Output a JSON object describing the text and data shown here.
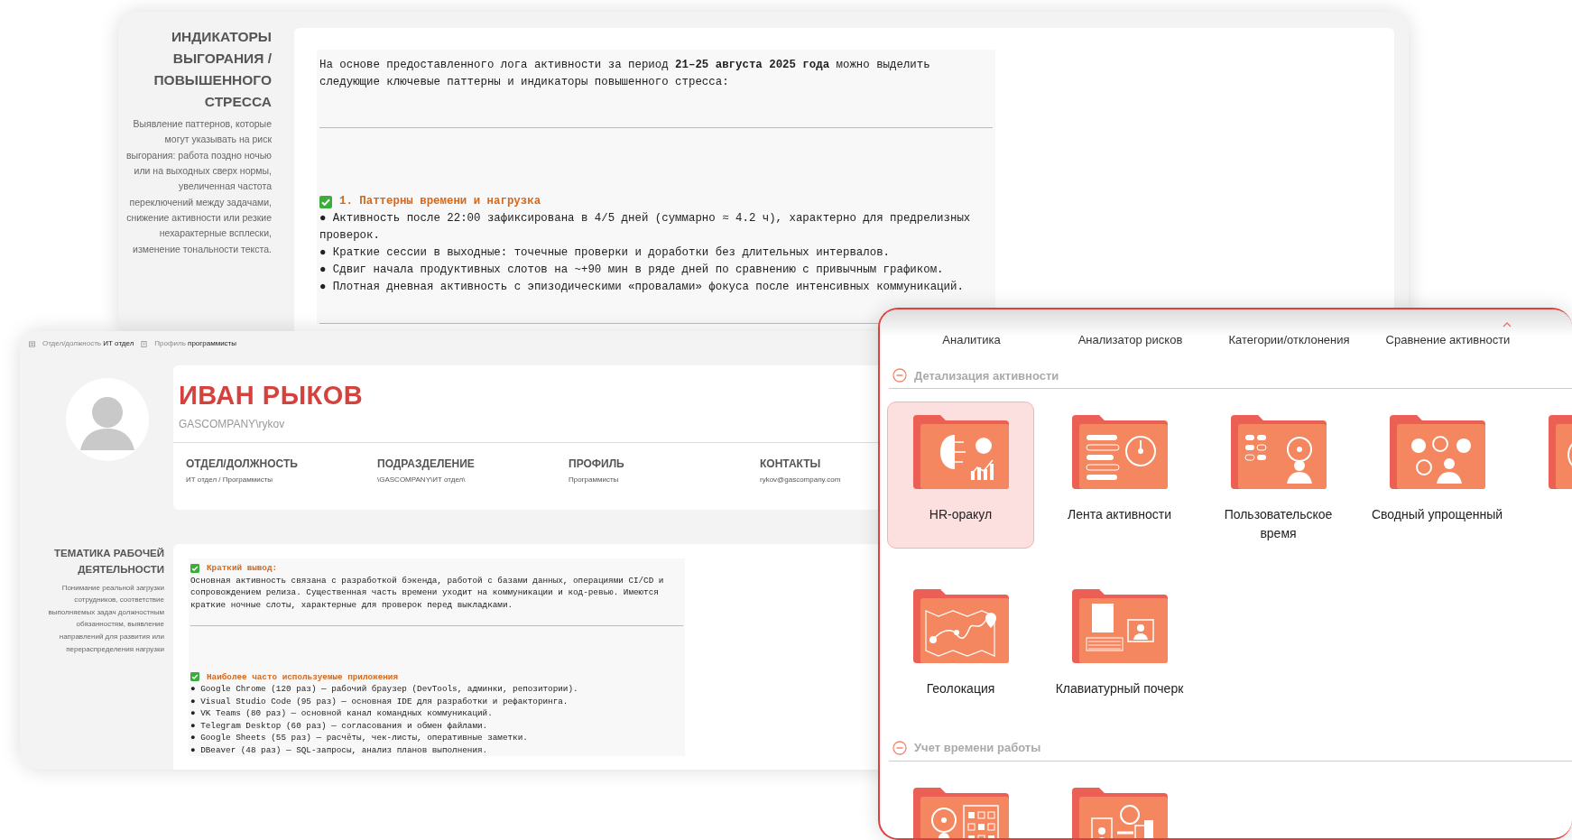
{
  "stress_panel": {
    "title": "ИНДИКАТОРЫ ВЫГОРАНИЯ / ПОВЫШЕННОГО СТРЕССА",
    "description": "Выявление паттернов, которые могут указывать на риск выгорания: работа поздно ночью или на выходных сверх нормы, увеличенная частота переключений между задачами, снижение активности или резкие нехарактерные всплески, изменение тональности текста.",
    "intro": "На основе предоставленного лога активности за период **21–25 августа 2025 года** можно выделить следующие ключевые паттерны и индикаторы повышенного стресса:",
    "sections": [
      {
        "heading": "1. Паттерны времени и нагрузка",
        "items": [
          "● Активность после 22:00 зафиксирована в 4/5 дней (суммарно ≈ 4.2 ч), характерно для предрелизных проверок.",
          "● Краткие сессии в выходные: точечные проверки и доработки без длительных интервалов.",
          "● Сдвиг начала продуктивных слотов на ~+90 мин в ряде дней по сравнению с привычным графиком.",
          "● Плотная дневная активность с эпизодическими «провалами» фокуса после интенсивных коммуникаций."
        ]
      }
    ]
  },
  "profile_panel": {
    "breadcrumbs": [
      {
        "label": "Отдел/должность",
        "value": "ИТ отдел"
      },
      {
        "label": "Профиль",
        "value": "программисты"
      }
    ],
    "name": "ИВАН РЫКОВ",
    "login": "GASCOMPANY\\rykov",
    "fields": [
      {
        "label": "ОТДЕЛ/ДОЛЖНОСТЬ",
        "value": "ИТ отдел / Программисты"
      },
      {
        "label": "ПОДРАЗДЕЛЕНИЕ",
        "value": "\\GASCOMPANY\\ИТ отдел\\"
      },
      {
        "label": "ПРОФИЛЬ",
        "value": "Программисты"
      },
      {
        "label": "КОНТАКТЫ",
        "value": "rykov@gascompany.com"
      }
    ],
    "topic": {
      "title": "ТЕМАТИКА РАБОЧЕЙ ДЕЯТЕЛЬНОСТИ",
      "description": "Понимание реальной загрузки сотрудников, соответствие выполняемых задач должностным обязанностям, выявление направлений для развития или перераспределения нагрузки",
      "summary_heading": "Краткий вывод:",
      "summary": "Основная активность связана с разработкой бэкенда, работой с базами данных, операциями CI/CD и сопровождением релиза. Существенная часть времени уходит на коммуникации и код-ревью. Имеются краткие ночные слоты, характерные для проверок перед выкладками.",
      "apps_heading": "Наиболее часто используемые приложения",
      "apps": [
        "● Google Chrome (120 раз) — рабочий браузер (DevTools, админки, репозитории).",
        "● Visual Studio Code (95 раз) — основная IDE для разработки и рефакторинга.",
        "● VK Teams (80 раз) — основной канал командных коммуникаций.",
        "● Telegram Desktop (60 раз) — согласования и обмен файлами.",
        "● Google Sheets (55 раз) — расчёты, чек-листы, оперативные заметки.",
        "● DBeaver (48 раз) — SQL-запросы, анализ планов выполнения."
      ]
    }
  },
  "reports_panel": {
    "top_row": [
      "Аналитика",
      "Анализатор рисков",
      "Категории/отклонения",
      "Сравнение активности"
    ],
    "groups": [
      {
        "title": "Детализация активности",
        "expanded": true,
        "tiles": [
          {
            "label": "HR-оракул",
            "selected": true
          },
          {
            "label": "Лента активности",
            "selected": false
          },
          {
            "label": "Пользовательское время",
            "selected": false
          },
          {
            "label": "Сводный упрощенный",
            "selected": false
          },
          {
            "selected": false
          },
          {
            "label": "Геолокация",
            "selected": false
          },
          {
            "label": "Клавиатурный почерк",
            "selected": false
          }
        ]
      },
      {
        "title": "Учет времени работы",
        "expanded": true,
        "tiles": [
          {
            "selected": false
          },
          {
            "selected": false
          }
        ]
      }
    ]
  }
}
